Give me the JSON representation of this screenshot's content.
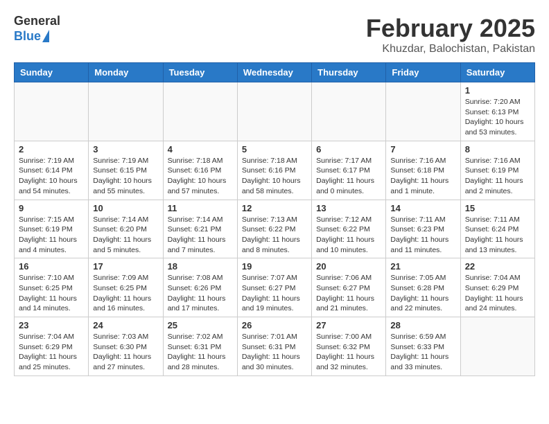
{
  "header": {
    "logo_general": "General",
    "logo_blue": "Blue",
    "month_year": "February 2025",
    "location": "Khuzdar, Balochistan, Pakistan"
  },
  "weekdays": [
    "Sunday",
    "Monday",
    "Tuesday",
    "Wednesday",
    "Thursday",
    "Friday",
    "Saturday"
  ],
  "weeks": [
    [
      {
        "day": "",
        "info": ""
      },
      {
        "day": "",
        "info": ""
      },
      {
        "day": "",
        "info": ""
      },
      {
        "day": "",
        "info": ""
      },
      {
        "day": "",
        "info": ""
      },
      {
        "day": "",
        "info": ""
      },
      {
        "day": "1",
        "info": "Sunrise: 7:20 AM\nSunset: 6:13 PM\nDaylight: 10 hours\nand 53 minutes."
      }
    ],
    [
      {
        "day": "2",
        "info": "Sunrise: 7:19 AM\nSunset: 6:14 PM\nDaylight: 10 hours\nand 54 minutes."
      },
      {
        "day": "3",
        "info": "Sunrise: 7:19 AM\nSunset: 6:15 PM\nDaylight: 10 hours\nand 55 minutes."
      },
      {
        "day": "4",
        "info": "Sunrise: 7:18 AM\nSunset: 6:16 PM\nDaylight: 10 hours\nand 57 minutes."
      },
      {
        "day": "5",
        "info": "Sunrise: 7:18 AM\nSunset: 6:16 PM\nDaylight: 10 hours\nand 58 minutes."
      },
      {
        "day": "6",
        "info": "Sunrise: 7:17 AM\nSunset: 6:17 PM\nDaylight: 11 hours\nand 0 minutes."
      },
      {
        "day": "7",
        "info": "Sunrise: 7:16 AM\nSunset: 6:18 PM\nDaylight: 11 hours\nand 1 minute."
      },
      {
        "day": "8",
        "info": "Sunrise: 7:16 AM\nSunset: 6:19 PM\nDaylight: 11 hours\nand 2 minutes."
      }
    ],
    [
      {
        "day": "9",
        "info": "Sunrise: 7:15 AM\nSunset: 6:19 PM\nDaylight: 11 hours\nand 4 minutes."
      },
      {
        "day": "10",
        "info": "Sunrise: 7:14 AM\nSunset: 6:20 PM\nDaylight: 11 hours\nand 5 minutes."
      },
      {
        "day": "11",
        "info": "Sunrise: 7:14 AM\nSunset: 6:21 PM\nDaylight: 11 hours\nand 7 minutes."
      },
      {
        "day": "12",
        "info": "Sunrise: 7:13 AM\nSunset: 6:22 PM\nDaylight: 11 hours\nand 8 minutes."
      },
      {
        "day": "13",
        "info": "Sunrise: 7:12 AM\nSunset: 6:22 PM\nDaylight: 11 hours\nand 10 minutes."
      },
      {
        "day": "14",
        "info": "Sunrise: 7:11 AM\nSunset: 6:23 PM\nDaylight: 11 hours\nand 11 minutes."
      },
      {
        "day": "15",
        "info": "Sunrise: 7:11 AM\nSunset: 6:24 PM\nDaylight: 11 hours\nand 13 minutes."
      }
    ],
    [
      {
        "day": "16",
        "info": "Sunrise: 7:10 AM\nSunset: 6:25 PM\nDaylight: 11 hours\nand 14 minutes."
      },
      {
        "day": "17",
        "info": "Sunrise: 7:09 AM\nSunset: 6:25 PM\nDaylight: 11 hours\nand 16 minutes."
      },
      {
        "day": "18",
        "info": "Sunrise: 7:08 AM\nSunset: 6:26 PM\nDaylight: 11 hours\nand 17 minutes."
      },
      {
        "day": "19",
        "info": "Sunrise: 7:07 AM\nSunset: 6:27 PM\nDaylight: 11 hours\nand 19 minutes."
      },
      {
        "day": "20",
        "info": "Sunrise: 7:06 AM\nSunset: 6:27 PM\nDaylight: 11 hours\nand 21 minutes."
      },
      {
        "day": "21",
        "info": "Sunrise: 7:05 AM\nSunset: 6:28 PM\nDaylight: 11 hours\nand 22 minutes."
      },
      {
        "day": "22",
        "info": "Sunrise: 7:04 AM\nSunset: 6:29 PM\nDaylight: 11 hours\nand 24 minutes."
      }
    ],
    [
      {
        "day": "23",
        "info": "Sunrise: 7:04 AM\nSunset: 6:29 PM\nDaylight: 11 hours\nand 25 minutes."
      },
      {
        "day": "24",
        "info": "Sunrise: 7:03 AM\nSunset: 6:30 PM\nDaylight: 11 hours\nand 27 minutes."
      },
      {
        "day": "25",
        "info": "Sunrise: 7:02 AM\nSunset: 6:31 PM\nDaylight: 11 hours\nand 28 minutes."
      },
      {
        "day": "26",
        "info": "Sunrise: 7:01 AM\nSunset: 6:31 PM\nDaylight: 11 hours\nand 30 minutes."
      },
      {
        "day": "27",
        "info": "Sunrise: 7:00 AM\nSunset: 6:32 PM\nDaylight: 11 hours\nand 32 minutes."
      },
      {
        "day": "28",
        "info": "Sunrise: 6:59 AM\nSunset: 6:33 PM\nDaylight: 11 hours\nand 33 minutes."
      },
      {
        "day": "",
        "info": ""
      }
    ]
  ]
}
